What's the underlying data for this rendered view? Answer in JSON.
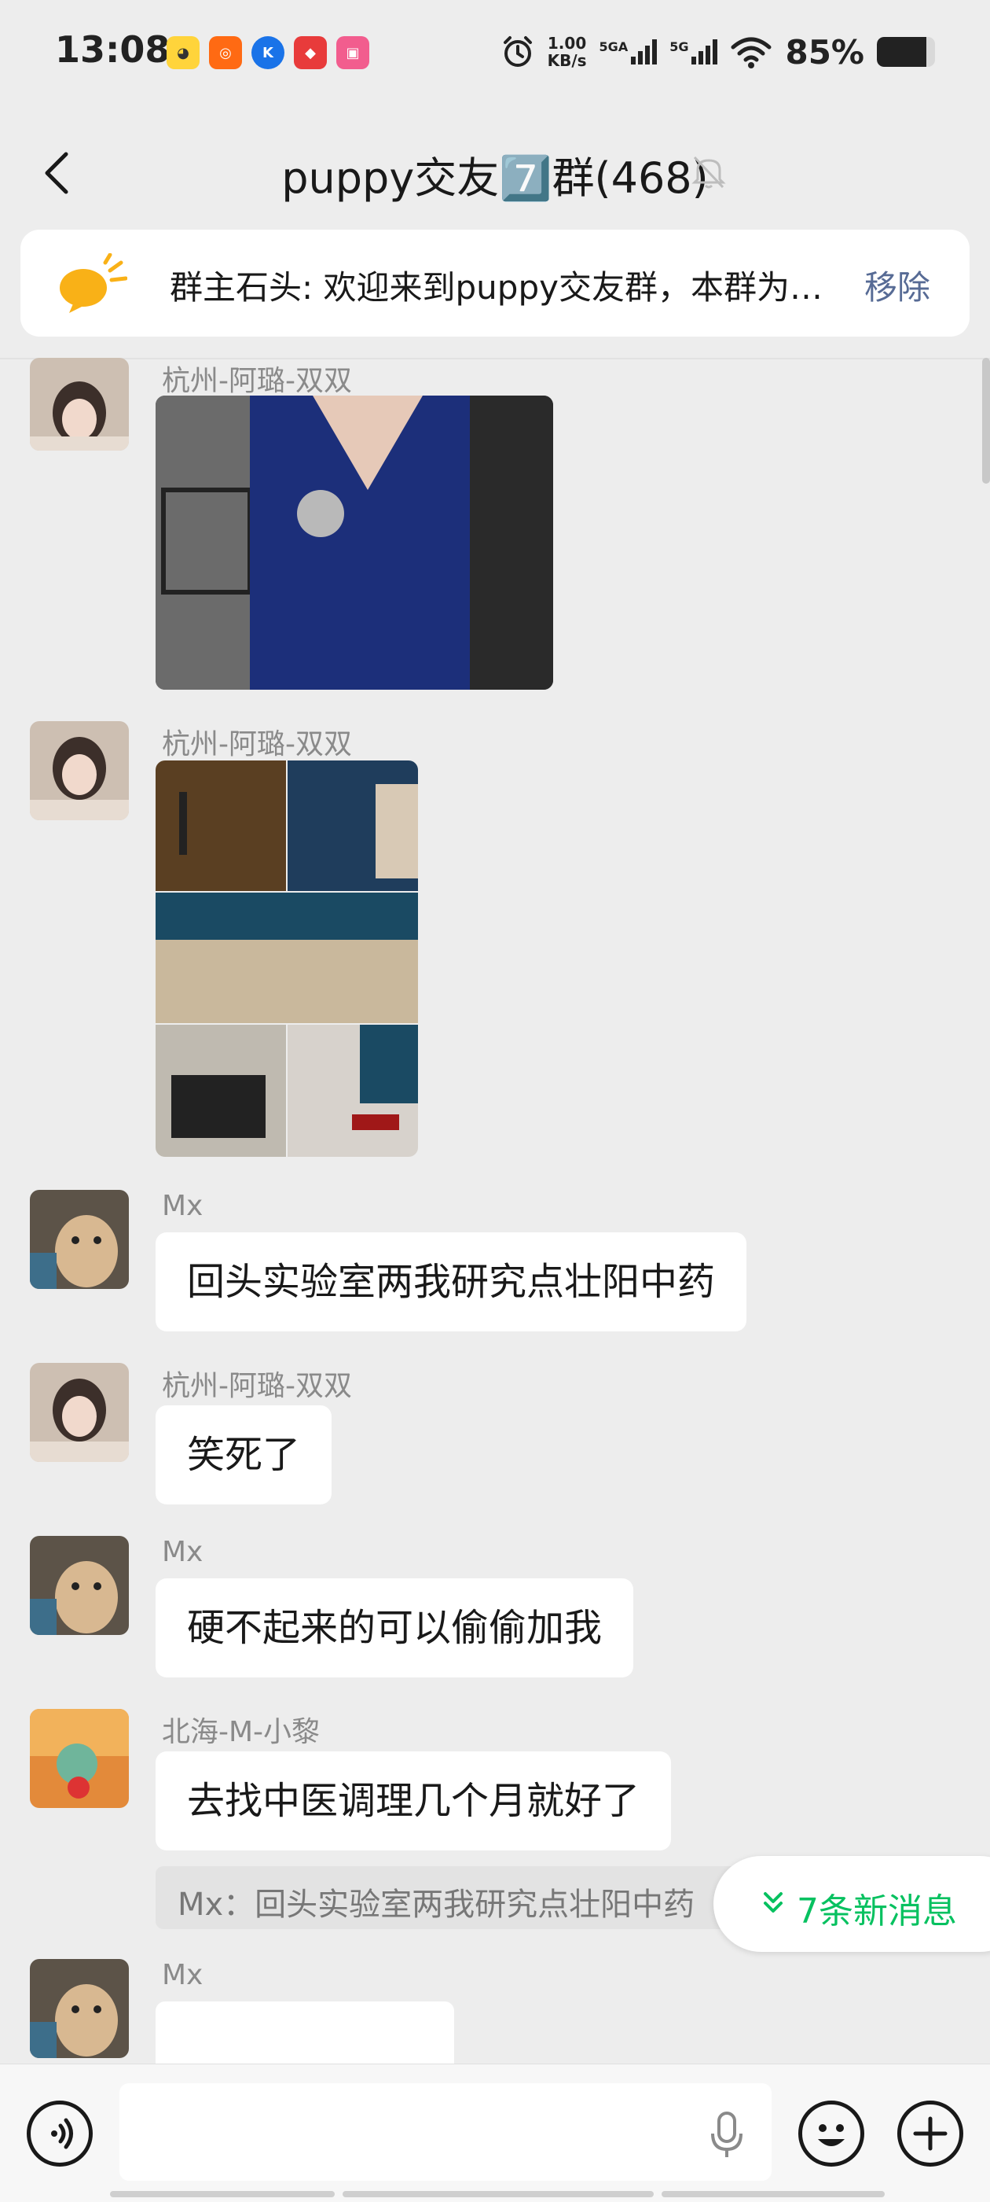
{
  "status_bar": {
    "time": "13:08",
    "net_speed_value": "1.00",
    "net_speed_unit": "KB/s",
    "sim1": "5GA",
    "sim2": "5G",
    "battery": "85%",
    "battery_level": 0.85,
    "app_icons": [
      "app-1",
      "app-2",
      "app-3",
      "app-4",
      "bilibili"
    ]
  },
  "header": {
    "title": "puppy交友7️⃣群(468)"
  },
  "notice": {
    "text": "群主石头: 欢迎来到puppy交友群，本群为…",
    "remove": "移除"
  },
  "messages": [
    {
      "sender": "杭州-阿璐-双双",
      "type": "image"
    },
    {
      "sender": "杭州-阿璐-双双",
      "type": "image"
    },
    {
      "sender": "Mx",
      "text": "回头实验室两我研究点壮阳中药"
    },
    {
      "sender": "杭州-阿璐-双双",
      "text": "笑死了"
    },
    {
      "sender": "Mx",
      "text": "硬不起来的可以偷偷加我"
    },
    {
      "sender": "北海-M-小黎",
      "text": "去找中医调理几个月就好了",
      "quote": "Mx：回头实验室两我研究点壮阳中药"
    },
    {
      "sender": "Mx",
      "type": "image"
    }
  ],
  "new_messages": "7条新消息",
  "colors": {
    "accent_green": "#07c160",
    "link_blue": "#576b95",
    "background": "#ededed"
  }
}
